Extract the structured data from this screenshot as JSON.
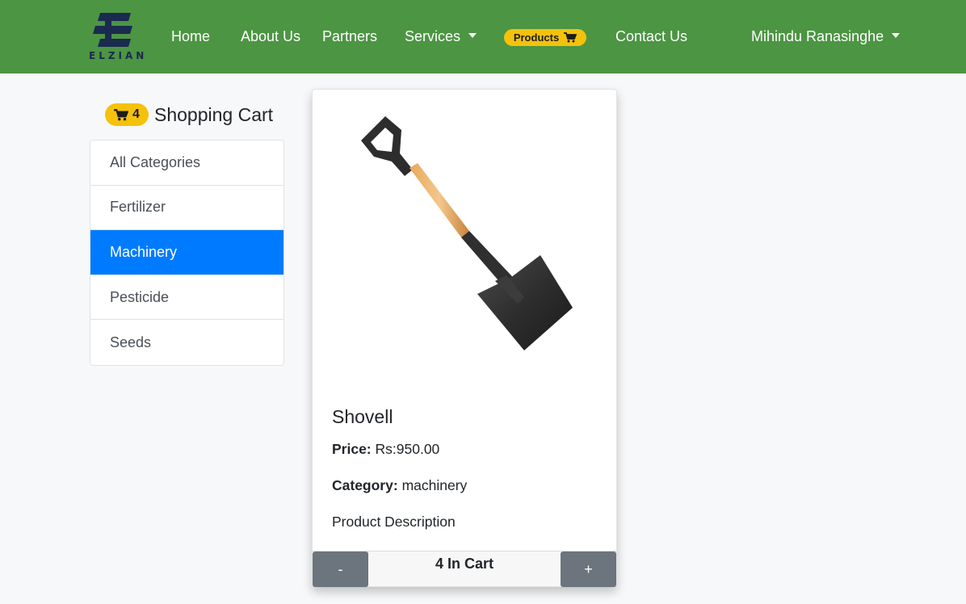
{
  "brand": {
    "logo_text": "ELZIAN"
  },
  "nav": {
    "home": "Home",
    "about": "About Us",
    "partners": "Partners",
    "services": "Services",
    "products": "Products",
    "contact": "Contact Us",
    "user": "Mihindu Ranasinghe"
  },
  "sidebar": {
    "cart_count": "4",
    "cart_title": "Shopping Cart",
    "categories": [
      {
        "label": "All Categories",
        "active": false
      },
      {
        "label": "Fertilizer",
        "active": false
      },
      {
        "label": "Machinery",
        "active": true
      },
      {
        "label": "Pesticide",
        "active": false
      },
      {
        "label": "Seeds",
        "active": false
      }
    ]
  },
  "product": {
    "name": "Shovell",
    "price_label": "Price:",
    "price_value": "Rs:950.00",
    "category_label": "Category:",
    "category_value": "machinery",
    "description": "Product Description",
    "image": "shovel-image",
    "minus_label": "-",
    "plus_label": "+",
    "cart_status": "4 In Cart"
  },
  "colors": {
    "navbar": "#4c9543",
    "badge": "#f4c20d",
    "active_category": "#007bff",
    "qty_button": "#6c757d"
  }
}
